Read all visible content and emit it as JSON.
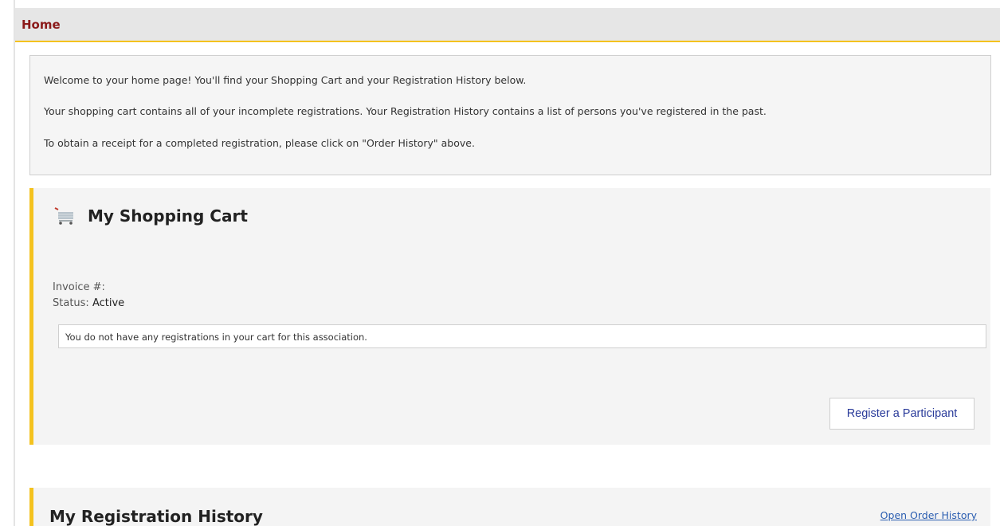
{
  "header": {
    "title": "Home"
  },
  "intro": {
    "line1": "Welcome to your home page! You'll find your Shopping Cart and your Registration History below.",
    "line2": "Your shopping cart contains all of your incomplete registrations. Your Registration History contains a list of persons you've registered in the past.",
    "line3": "To obtain a receipt for a completed registration, please click on \"Order History\" above."
  },
  "cart": {
    "title": "My Shopping Cart",
    "icon": "shopping-cart-icon",
    "invoice_label": "Invoice #:",
    "invoice_value": "",
    "status_label": "Status:",
    "status_value": "Active",
    "empty_message": "You do not have any registrations in your cart for this association.",
    "register_button": "Register a Participant"
  },
  "history": {
    "title": "My Registration History",
    "open_order_history": "Open Order History"
  },
  "colors": {
    "accent": "#f4c21e",
    "header_title": "#8b1a1a",
    "link": "#2a5db0"
  }
}
